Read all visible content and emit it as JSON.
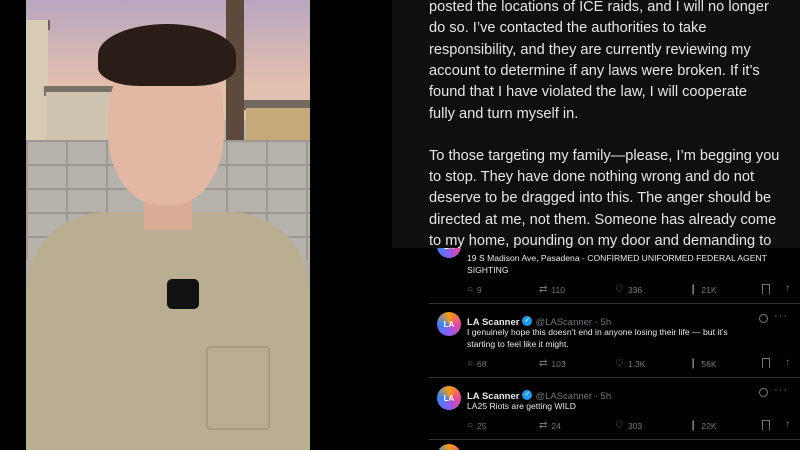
{
  "statement": {
    "lines": [
      "posted the locations of ICE raids, and I will no longer",
      "do so. I’ve contacted the authorities to take",
      "responsibility, and they are currently reviewing my",
      "account to determine if any laws were broken. If it’s",
      "found that I have violated the law, I will cooperate",
      "fully and turn myself in.",
      "To those targeting my family—please, I’m begging you",
      "to stop. They have done nothing wrong and do not",
      "deserve to be dragged into this. The anger should be",
      "directed at me, not them. Someone has already come",
      "to my home, pounding on my door and demanding to"
    ]
  },
  "feed": {
    "partial_tweet": {
      "text_lines": [
        "19 S Madison Ave, Pasadena - CONFIRMED UNIFORMED FEDERAL AGENT",
        "SIGHTING"
      ],
      "replies": "9",
      "reposts": "110",
      "likes": "336",
      "views": "21K"
    },
    "tweets": [
      {
        "name": "LA Scanner",
        "handle": "@LAScanner · 5h",
        "avatar_text": "LA",
        "text_lines": [
          "I genuinely hope this doesn’t end in anyone losing their life — but it’s",
          "starting to feel like it might."
        ],
        "replies": "68",
        "reposts": "103",
        "likes": "1.3K",
        "views": "56K"
      },
      {
        "name": "LA Scanner",
        "handle": "@LAScanner · 5h",
        "avatar_text": "LA",
        "text_lines": [
          "LA25 Riots are getting WILD"
        ],
        "replies": "25",
        "reposts": "24",
        "likes": "303",
        "views": "22K"
      }
    ]
  },
  "icons": {
    "reply": "💬",
    "repost": "⇄",
    "like": "♡",
    "views": "❙",
    "share": "↑",
    "more": "···"
  }
}
